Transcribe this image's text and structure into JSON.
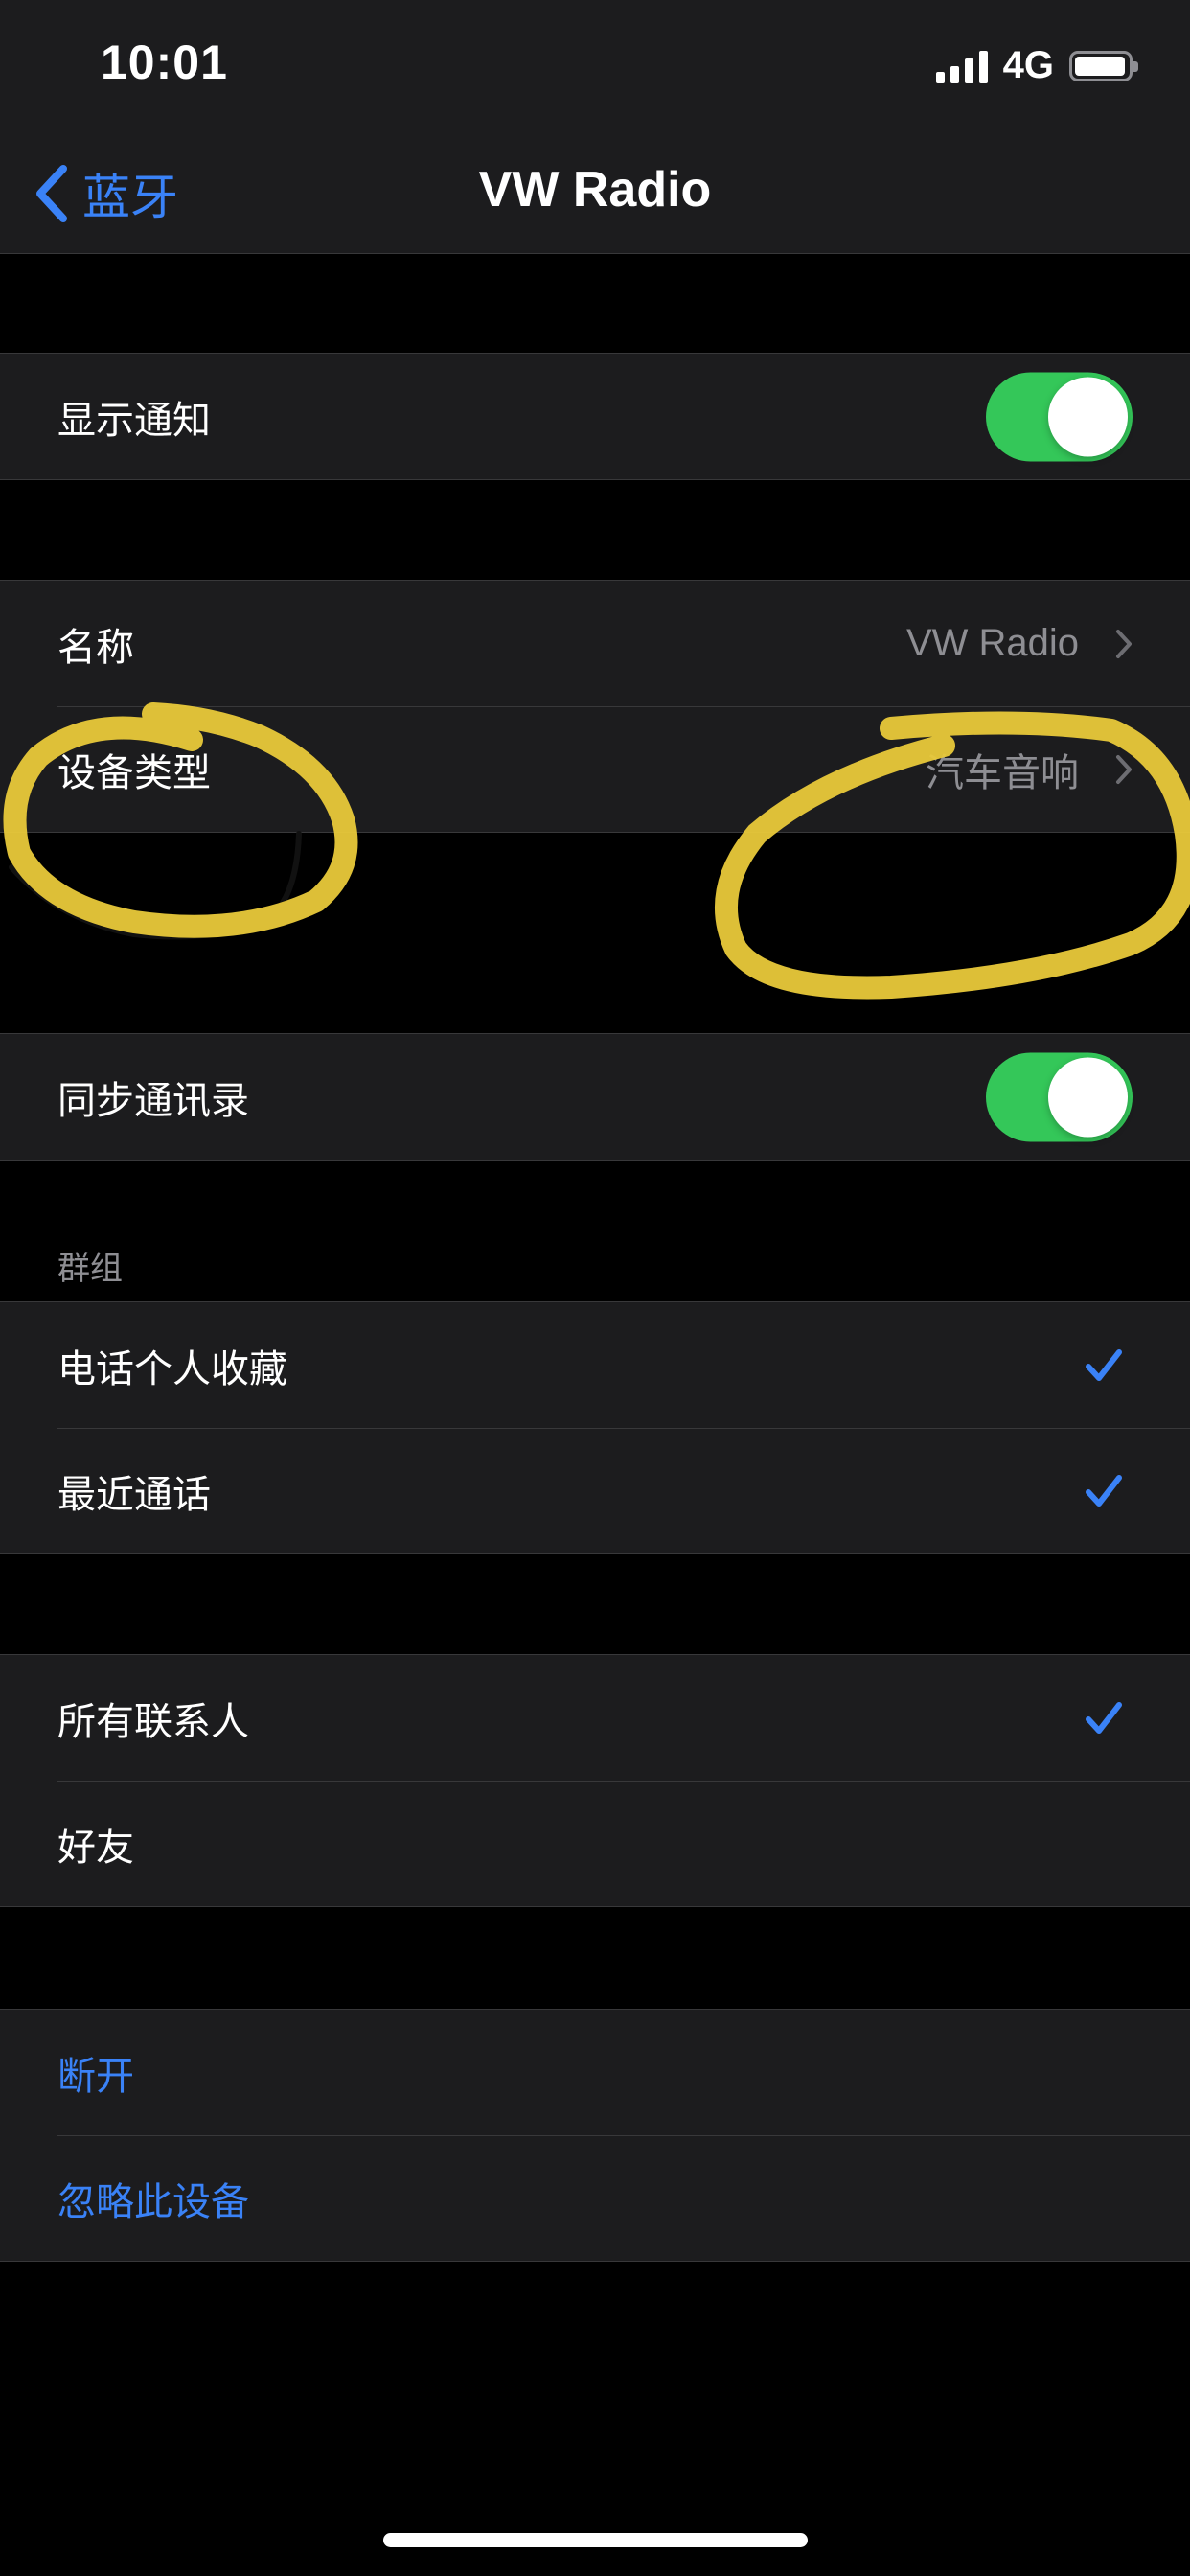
{
  "status_bar": {
    "time": "10:01",
    "network": "4G",
    "signal_icon": "cellular-signal-icon",
    "battery_icon": "battery-icon",
    "battery_level": 0.88
  },
  "nav": {
    "back_label": "蓝牙",
    "back_icon": "chevron-left-icon",
    "title": "VW Radio"
  },
  "settings": {
    "show_notifications": {
      "label": "显示通知",
      "on": true
    },
    "name": {
      "label": "名称",
      "value": "VW Radio"
    },
    "device_type": {
      "label": "设备类型",
      "value": "汽车音响"
    },
    "sync_contacts": {
      "label": "同步通讯录",
      "on": true
    }
  },
  "groups": {
    "header": "群组",
    "items": [
      {
        "label": "电话个人收藏",
        "checked": true
      },
      {
        "label": "最近通话",
        "checked": true
      }
    ]
  },
  "contacts": {
    "items": [
      {
        "label": "所有联系人",
        "checked": true
      },
      {
        "label": "好友",
        "checked": false
      }
    ]
  },
  "actions": {
    "disconnect": "断开",
    "forget": "忽略此设备"
  },
  "colors": {
    "accent": "#3a82f7",
    "toggle_on": "#34c759",
    "annotation": "#e9c93a"
  }
}
